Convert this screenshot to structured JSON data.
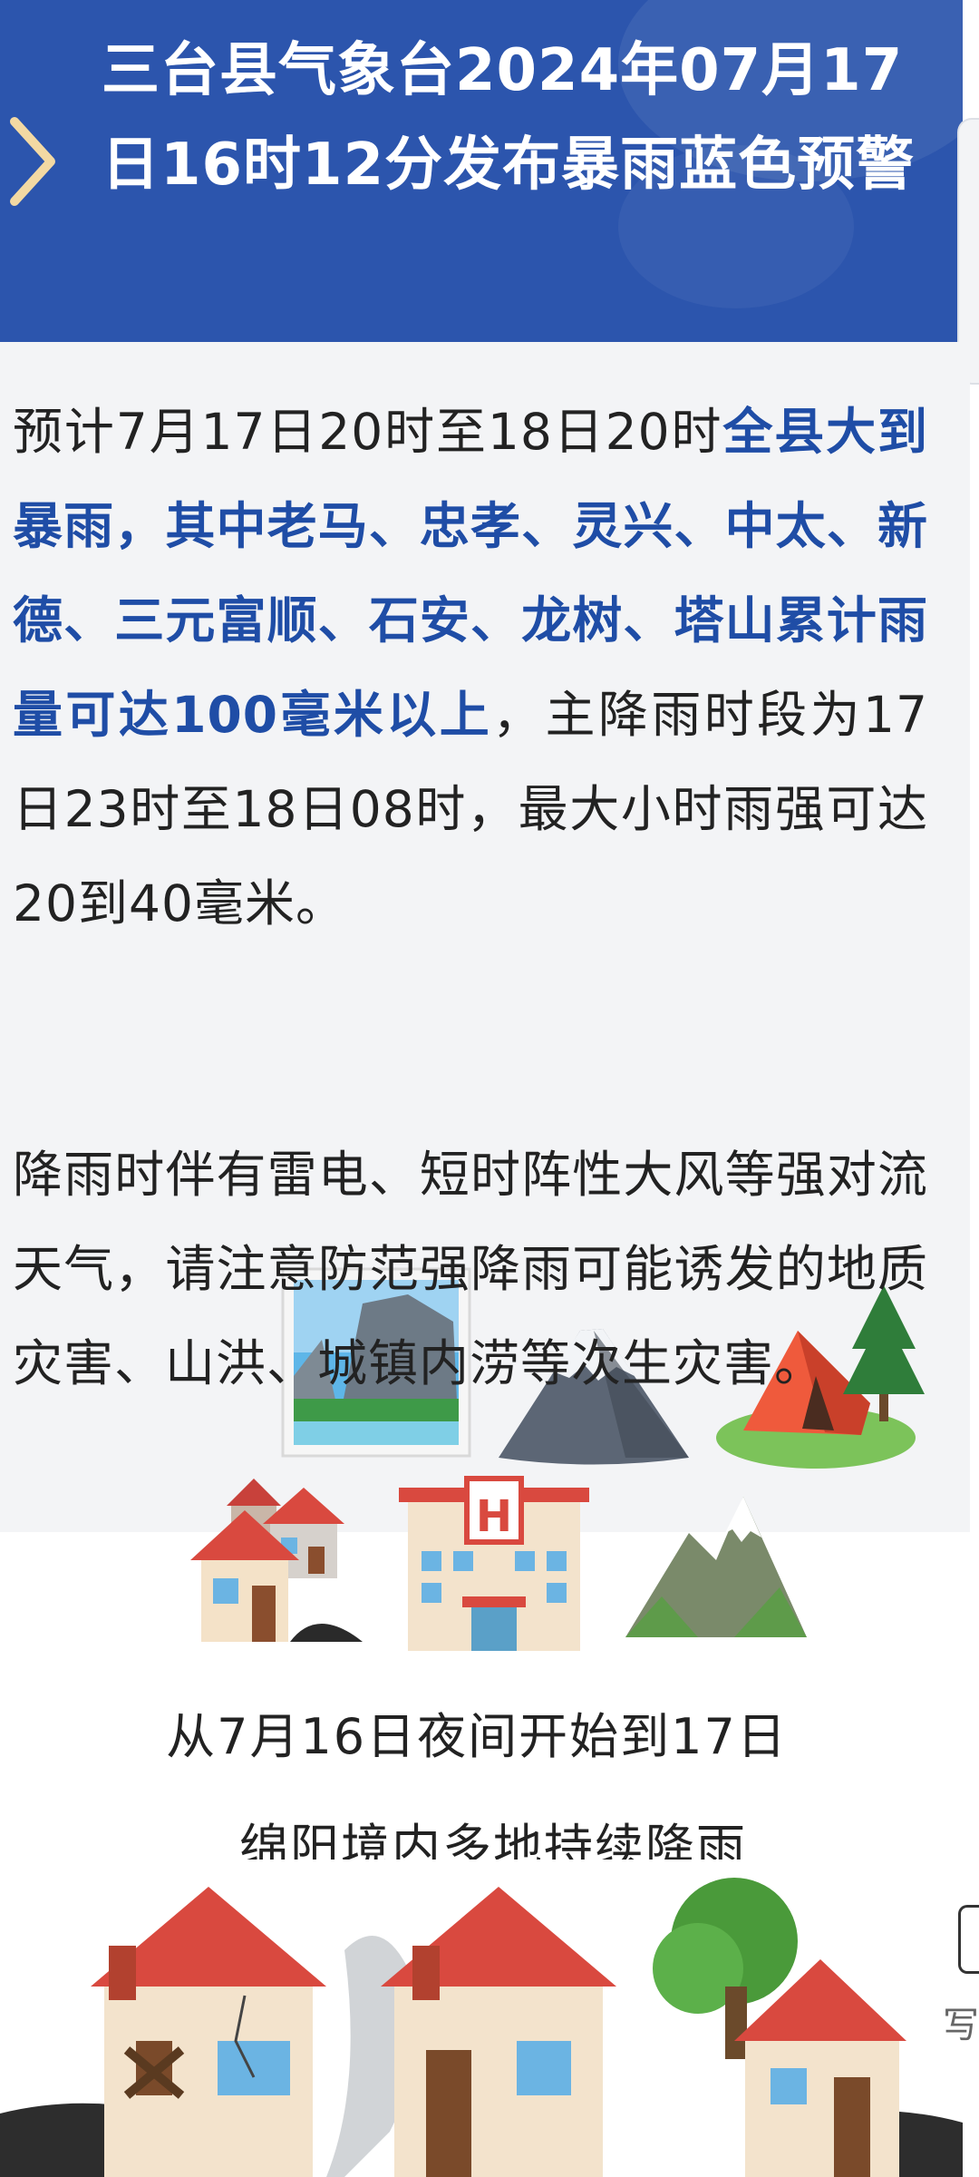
{
  "header": {
    "title": "三台县气象台2024年07月17日16时12分发布暴雨蓝色预警",
    "accent_color": "#2c55ad"
  },
  "content": {
    "para1": {
      "intro": "预计7月17日20时至18日20时",
      "highlight": "全县大到暴雨，其中老马、忠孝、灵兴、中太、新德、三元富顺、石安、龙树、塔山累计雨量可达100毫米以上",
      "rest": "，主降雨时段为17日23时至18日08时，最大小时雨强可达20到40毫米。"
    },
    "para2": "降雨时伴有雷电、短时阵性大风等强对流天气，请注意防范强降雨可能诱发的地质灾害、山洪、城镇内涝等次生灾害。",
    "highlight_color": "#1f4da6",
    "emoji_row1": [
      "national-park-icon",
      "mountain-icon",
      "camping-icon"
    ]
  },
  "lower": {
    "emoji_row2": [
      "houses-icon",
      "hotel-icon",
      "snow-mountain-icon"
    ],
    "caption_line1": "从7月16日夜间开始到17日",
    "caption_line2": "绵阳境内多地持续降雨",
    "bottom_images": [
      "damaged-house-icon",
      "house-icon",
      "house-with-tree-icon"
    ]
  },
  "side": {
    "char": "写"
  }
}
